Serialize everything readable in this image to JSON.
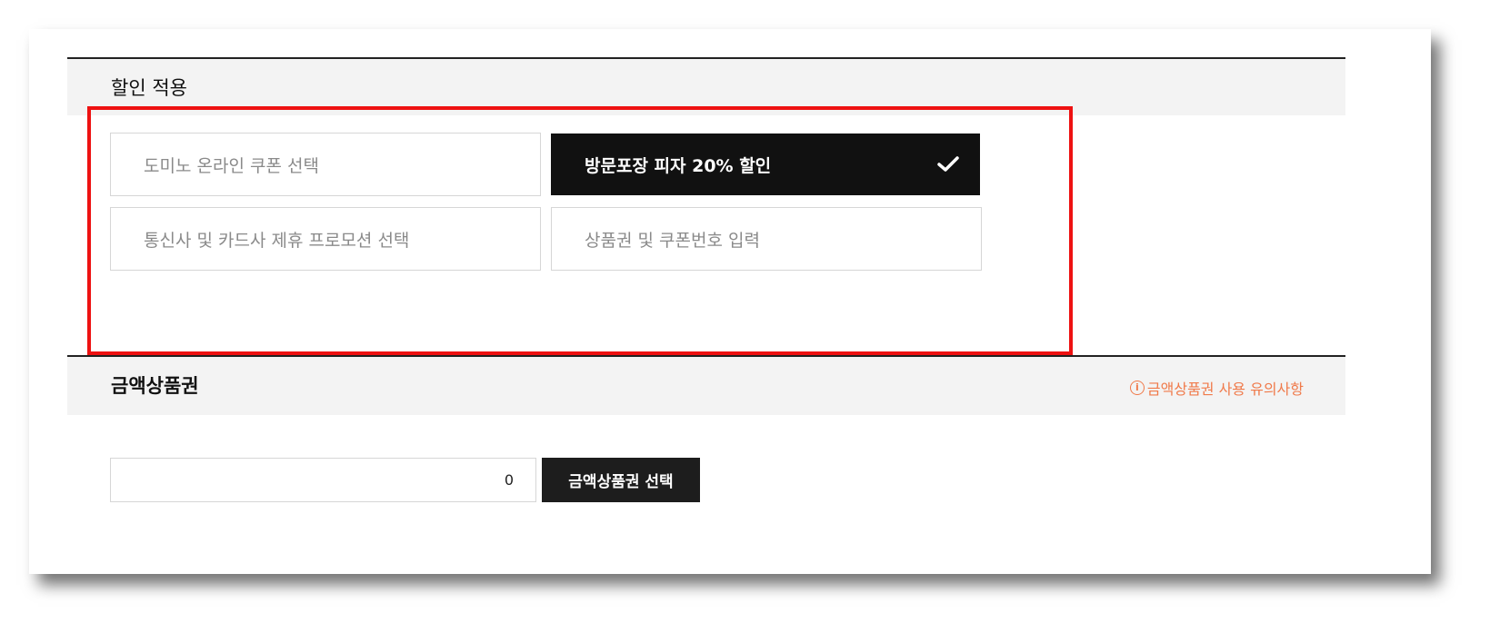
{
  "discount": {
    "title": "할인 적용",
    "options": [
      {
        "label": "도미노 온라인 쿠폰 선택",
        "selected": false
      },
      {
        "label": "방문포장 피자 20% 할인",
        "selected": true
      },
      {
        "label": "통신사 및 카드사 제휴 프로모션 선택",
        "selected": false
      },
      {
        "label": "상품권 및 쿠폰번호 입력",
        "selected": false
      }
    ]
  },
  "gift_card": {
    "title": "금액상품권",
    "notice_label": "금액상품권 사용 유의사항",
    "notice_icon": "info-icon",
    "amount_value": "0",
    "select_button_label": "금액상품권 선택"
  },
  "colors": {
    "highlight": "#ee1111",
    "selected_bg": "#111111",
    "notice": "#f07a4a"
  }
}
